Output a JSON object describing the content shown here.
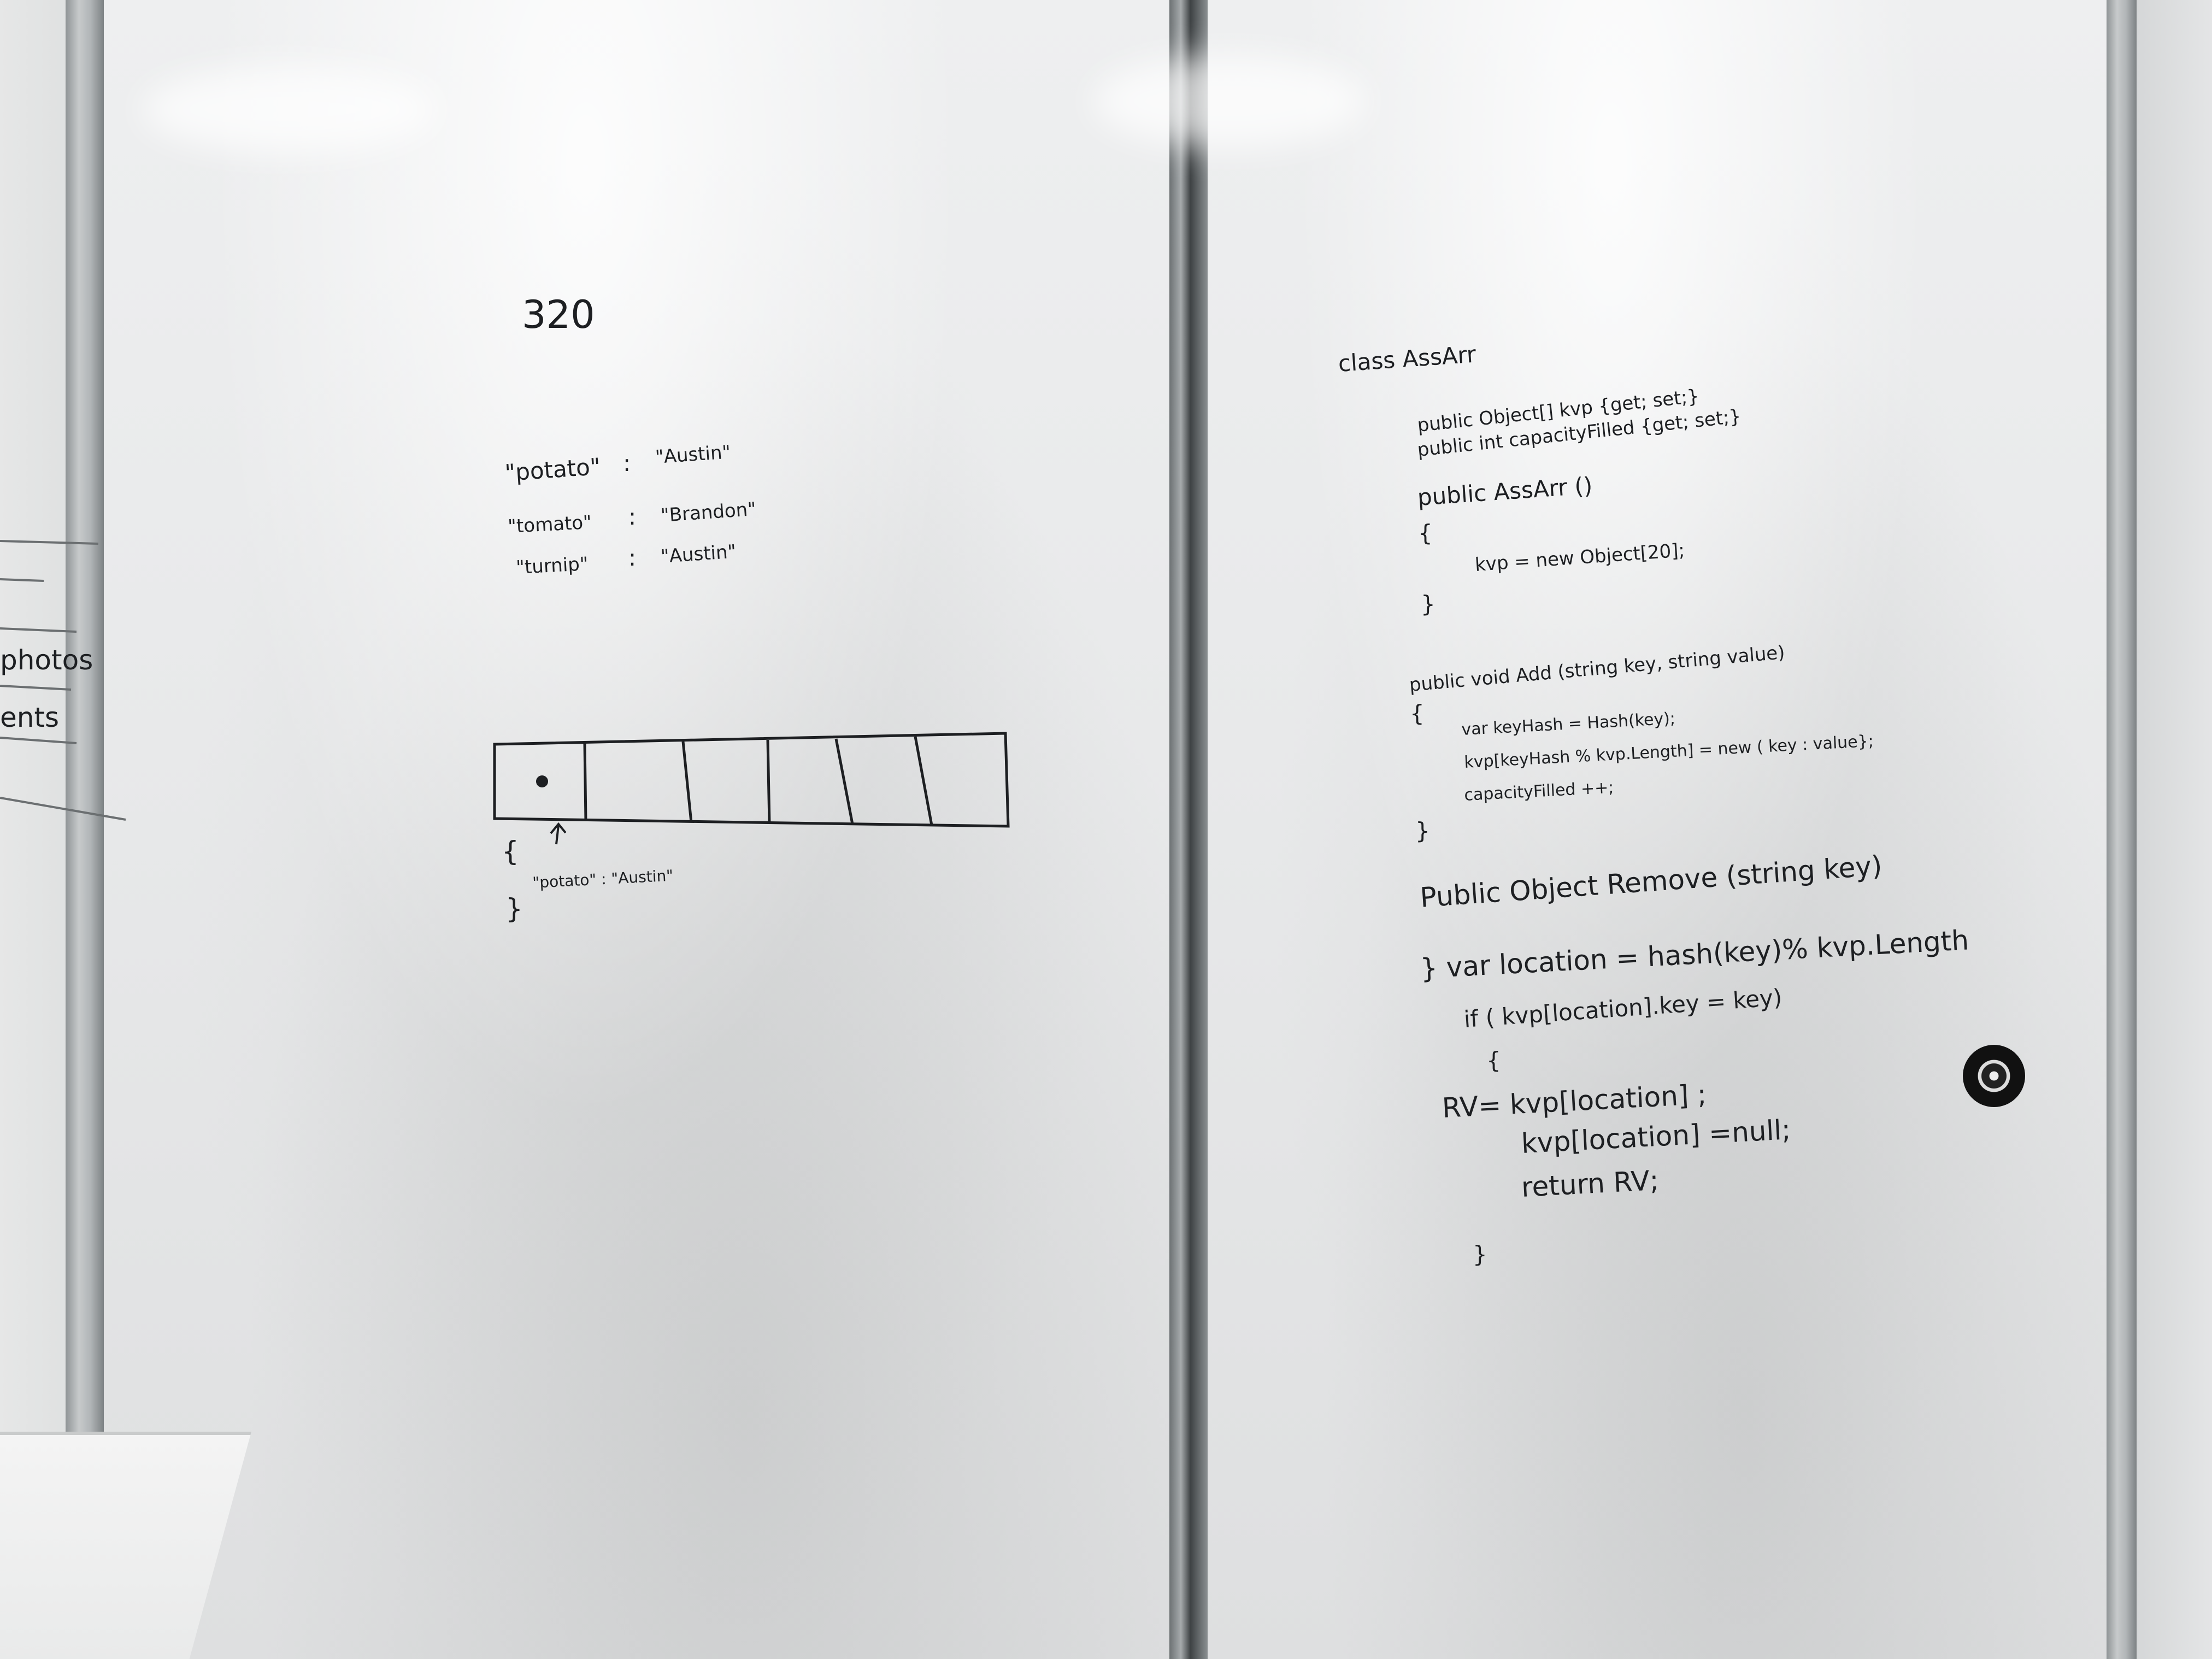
{
  "left_board": {
    "heading": "320",
    "pairs": [
      {
        "key": "\"potato\"",
        "sep": ":",
        "value": "\"Austin\""
      },
      {
        "key": "\"tomato\"",
        "sep": ":",
        "value": "\"Brandon\""
      },
      {
        "key": "\"turnip\"",
        "sep": ":",
        "value": "\"Austin\""
      }
    ],
    "array_cells": 6,
    "bucket_open": "{",
    "bucket_entry": "\"potato\" : \"Austin\"",
    "bucket_close": "}"
  },
  "edge_board": {
    "fragments": [
      "photos",
      "ents"
    ]
  },
  "right_board": {
    "code_lines": [
      "class   AssArr",
      "public   Object[] kvp {get; set;}",
      "public   int   capacityFilled {get; set;}",
      "public  AssArr ()",
      "{",
      "kvp  =  new  Object[20];",
      "}",
      "public  void   Add (string  key, string  value)",
      "{",
      "var  keyHash  =  Hash(key);",
      "kvp[keyHash % kvp.Length]  =  new  ( key : value};",
      "capacityFilled ++;",
      "}",
      "Public Object Remove (string key)",
      "}  var location = hash(key)% kvp.Length",
      "if ( kvp[location].key = key)",
      "{",
      "RV=   kvp[location] ;",
      "kvp[location] =null;",
      "return RV;",
      "}"
    ]
  }
}
